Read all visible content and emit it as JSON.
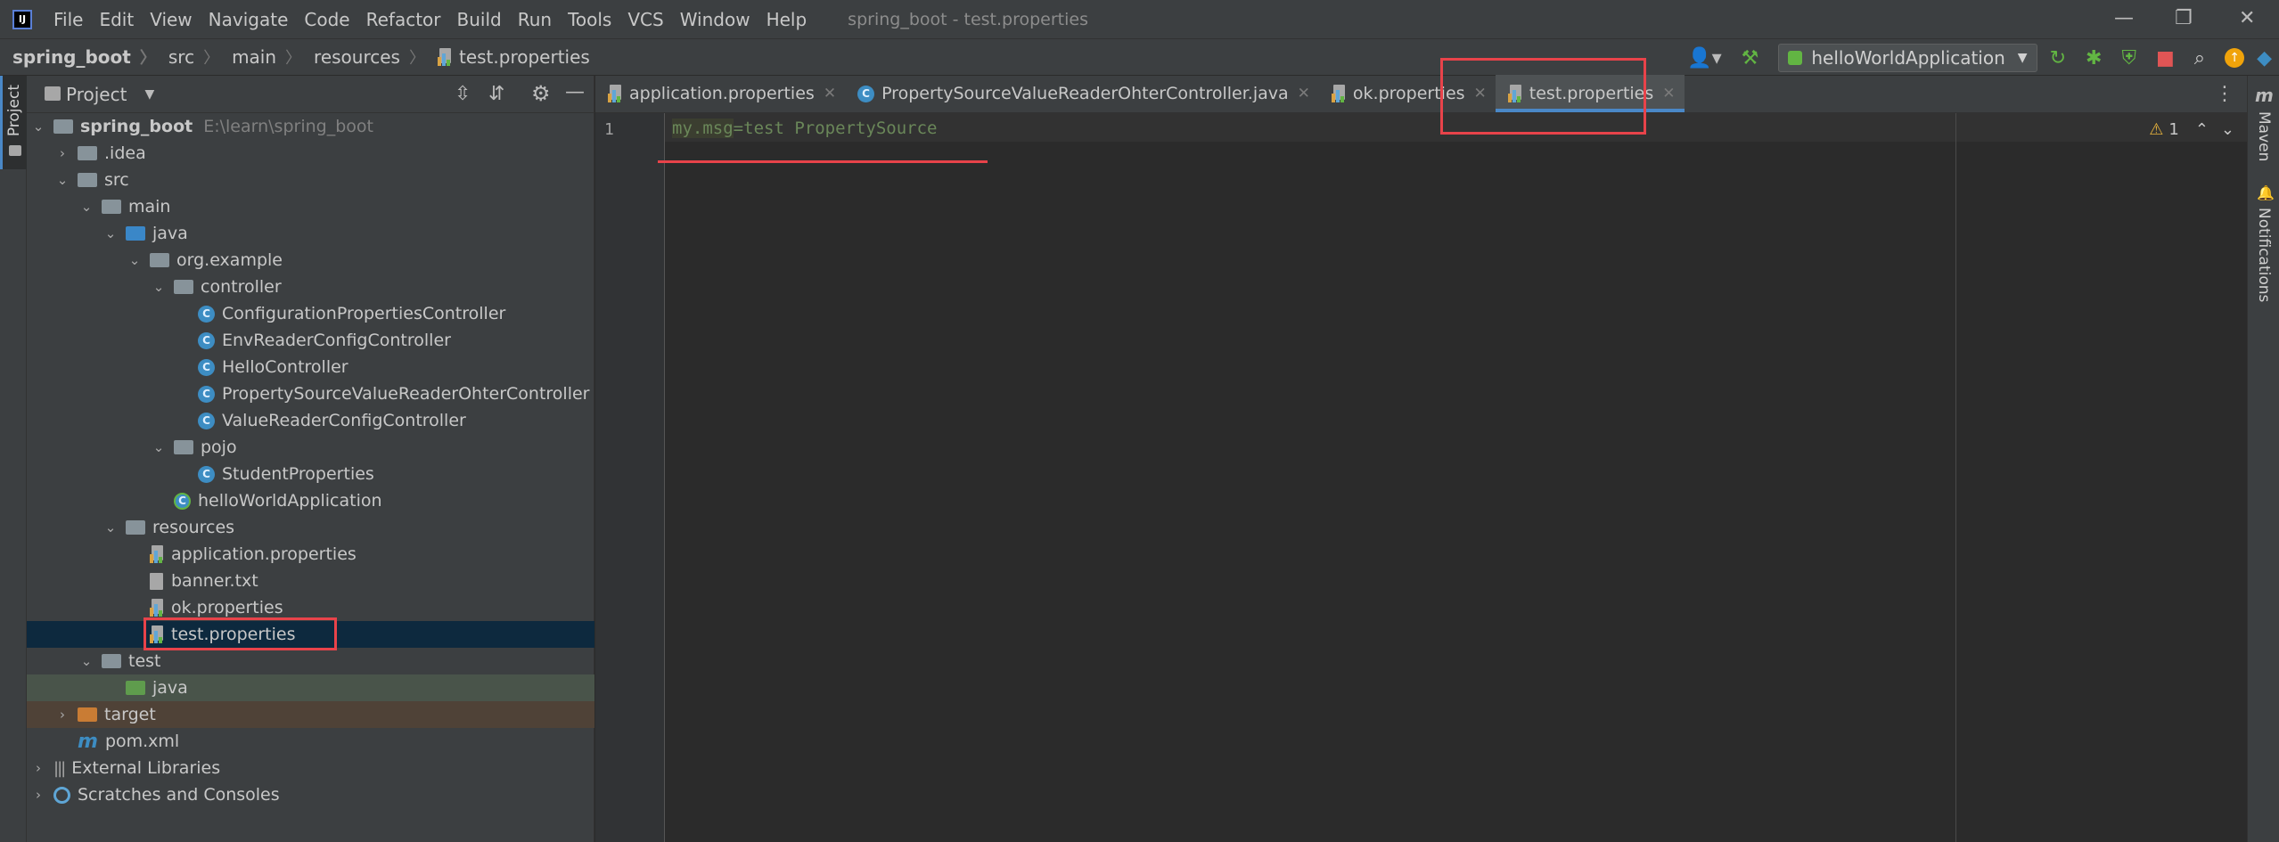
{
  "menubar": {
    "items": [
      "File",
      "Edit",
      "View",
      "Navigate",
      "Code",
      "Refactor",
      "Build",
      "Run",
      "Tools",
      "VCS",
      "Window",
      "Help"
    ],
    "title": "spring_boot - test.properties"
  },
  "breadcrumb": [
    "spring_boot",
    "src",
    "main",
    "resources",
    "test.properties"
  ],
  "toolbar": {
    "run_config": "helloWorldApplication"
  },
  "left_strip": {
    "project_tab": "Project"
  },
  "project_panel": {
    "title": "Project",
    "tree": [
      {
        "label": "spring_boot",
        "extra": "E:\\learn\\spring_boot",
        "depth": 0,
        "kind": "module",
        "expanded": true,
        "bold": true
      },
      {
        "label": ".idea",
        "depth": 1,
        "kind": "folder",
        "expanded": false
      },
      {
        "label": "src",
        "depth": 1,
        "kind": "folder",
        "expanded": true
      },
      {
        "label": "main",
        "depth": 2,
        "kind": "folder",
        "expanded": true
      },
      {
        "label": "java",
        "depth": 3,
        "kind": "folder-blue",
        "expanded": true
      },
      {
        "label": "org.example",
        "depth": 4,
        "kind": "package",
        "expanded": true
      },
      {
        "label": "controller",
        "depth": 5,
        "kind": "package",
        "expanded": true
      },
      {
        "label": "ConfigurationPropertiesController",
        "depth": 6,
        "kind": "class"
      },
      {
        "label": "EnvReaderConfigController",
        "depth": 6,
        "kind": "class"
      },
      {
        "label": "HelloController",
        "depth": 6,
        "kind": "class"
      },
      {
        "label": "PropertySourceValueReaderOhterController",
        "depth": 6,
        "kind": "class"
      },
      {
        "label": "ValueReaderConfigController",
        "depth": 6,
        "kind": "class"
      },
      {
        "label": "pojo",
        "depth": 5,
        "kind": "package",
        "expanded": true
      },
      {
        "label": "StudentProperties",
        "depth": 6,
        "kind": "class"
      },
      {
        "label": "helloWorldApplication",
        "depth": 5,
        "kind": "spring-class"
      },
      {
        "label": "resources",
        "depth": 3,
        "kind": "folder-res",
        "expanded": true
      },
      {
        "label": "application.properties",
        "depth": 4,
        "kind": "properties"
      },
      {
        "label": "banner.txt",
        "depth": 4,
        "kind": "text"
      },
      {
        "label": "ok.properties",
        "depth": 4,
        "kind": "properties"
      },
      {
        "label": "test.properties",
        "depth": 4,
        "kind": "properties",
        "selected": true
      },
      {
        "label": "test",
        "depth": 2,
        "kind": "folder",
        "expanded": true
      },
      {
        "label": "java",
        "depth": 3,
        "kind": "folder-green",
        "highlight": "test"
      },
      {
        "label": "target",
        "depth": 1,
        "kind": "folder-orange",
        "expanded": false,
        "highlight": "target"
      },
      {
        "label": "pom.xml",
        "depth": 1,
        "kind": "maven"
      },
      {
        "label": "External Libraries",
        "depth": 0,
        "kind": "libraries",
        "expanded": false
      },
      {
        "label": "Scratches and Consoles",
        "depth": 0,
        "kind": "scratches",
        "expanded": false
      }
    ]
  },
  "editor": {
    "tabs": [
      {
        "label": "application.properties",
        "icon": "properties",
        "active": false
      },
      {
        "label": "PropertySourceValueReaderOhterController.java",
        "icon": "class",
        "active": false
      },
      {
        "label": "ok.properties",
        "icon": "properties",
        "active": false
      },
      {
        "label": "test.properties",
        "icon": "properties",
        "active": true
      }
    ],
    "line_number": "1",
    "code_key_a": "my",
    "code_dot": ".",
    "code_key_b": "msg",
    "code_eq": "=",
    "code_value": "test PropertySource",
    "warning_count": "1"
  },
  "right_strip": {
    "maven": "Maven",
    "notifications": "Notifications"
  }
}
